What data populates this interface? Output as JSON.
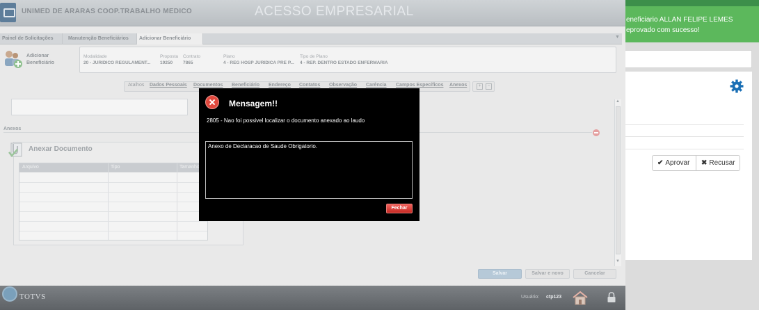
{
  "app": {
    "org_name": "UNIMED DE ARARAS COOP.TRABALHO MEDICO",
    "portal_title_a": "ACESSO",
    "portal_title_b": "EMPRESARIAL"
  },
  "tabs": [
    {
      "label": "Painel de Solicitações"
    },
    {
      "label": "Manutenção Beneficiários"
    },
    {
      "label": "Adicionar Beneficiário",
      "active": true
    }
  ],
  "beneficiary": {
    "title": "Adicionar\nBeneficiário",
    "fields": [
      {
        "label": "Modalidade",
        "value": "20 - JURIDICO REGULAMENT..."
      },
      {
        "label": "Proposta",
        "value": "19250"
      },
      {
        "label": "Contrato",
        "value": "7865"
      },
      {
        "label": "Plano",
        "value": "4 - REG HOSP JURIDICA PRE P..."
      },
      {
        "label": "Tipo de Plano",
        "value": "4 - REP. DENTRO ESTADO ENFERMARIA"
      }
    ]
  },
  "subtabs": {
    "prefix": "Atalhos",
    "items": [
      "Dados Pessoais",
      "Documentos",
      "Beneficiário",
      "Endereço",
      "Contatos",
      "Observação",
      "Carência",
      "Campos Específicos",
      "Anexos"
    ]
  },
  "anexos": {
    "section_label": "Anexos",
    "panel_title": "Anexar Documento",
    "columns": [
      "Arquivo",
      "Tipo",
      "Tamanho"
    ]
  },
  "footer_buttons": {
    "save": "Salvar",
    "save_new": "Salvar e novo",
    "cancel": "Cancelar"
  },
  "footer": {
    "brand": "TOTVS",
    "user_label": "Usuário:",
    "user_value": "ctp123"
  },
  "modal": {
    "title": "Mensagem!!",
    "message": "2805 - Nao foi possivel localizar o documento anexado ao laudo",
    "detail": "Anexo de Declaracao de Saude Obrigatorio.",
    "close_label": "Fechar"
  },
  "right": {
    "notification": "eneficiario ALLAN FELIPE LEMES\neprovado com sucesso!",
    "approve_label": "Aprovar",
    "reject_label": "Recusar"
  },
  "colors": {
    "notify_green": "#5cb85c",
    "close_red": "#e0483d",
    "gear_blue": "#1a6fb5"
  }
}
